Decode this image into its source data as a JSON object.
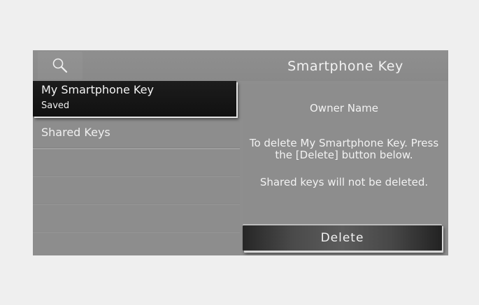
{
  "header": {
    "title": "Smartphone Key",
    "search_icon": "search-icon"
  },
  "sidebar": {
    "items": [
      {
        "label": "My Smartphone Key",
        "sublabel": "Saved",
        "selected": true
      },
      {
        "label": "Shared Keys",
        "selected": false
      }
    ]
  },
  "detail": {
    "owner_name": "Owner Name",
    "message_line1": "To delete My Smartphone Key. Press",
    "message_line2": "the [Delete] button below.",
    "message_shared": "Shared keys will not be deleted.",
    "delete_label": "Delete"
  }
}
